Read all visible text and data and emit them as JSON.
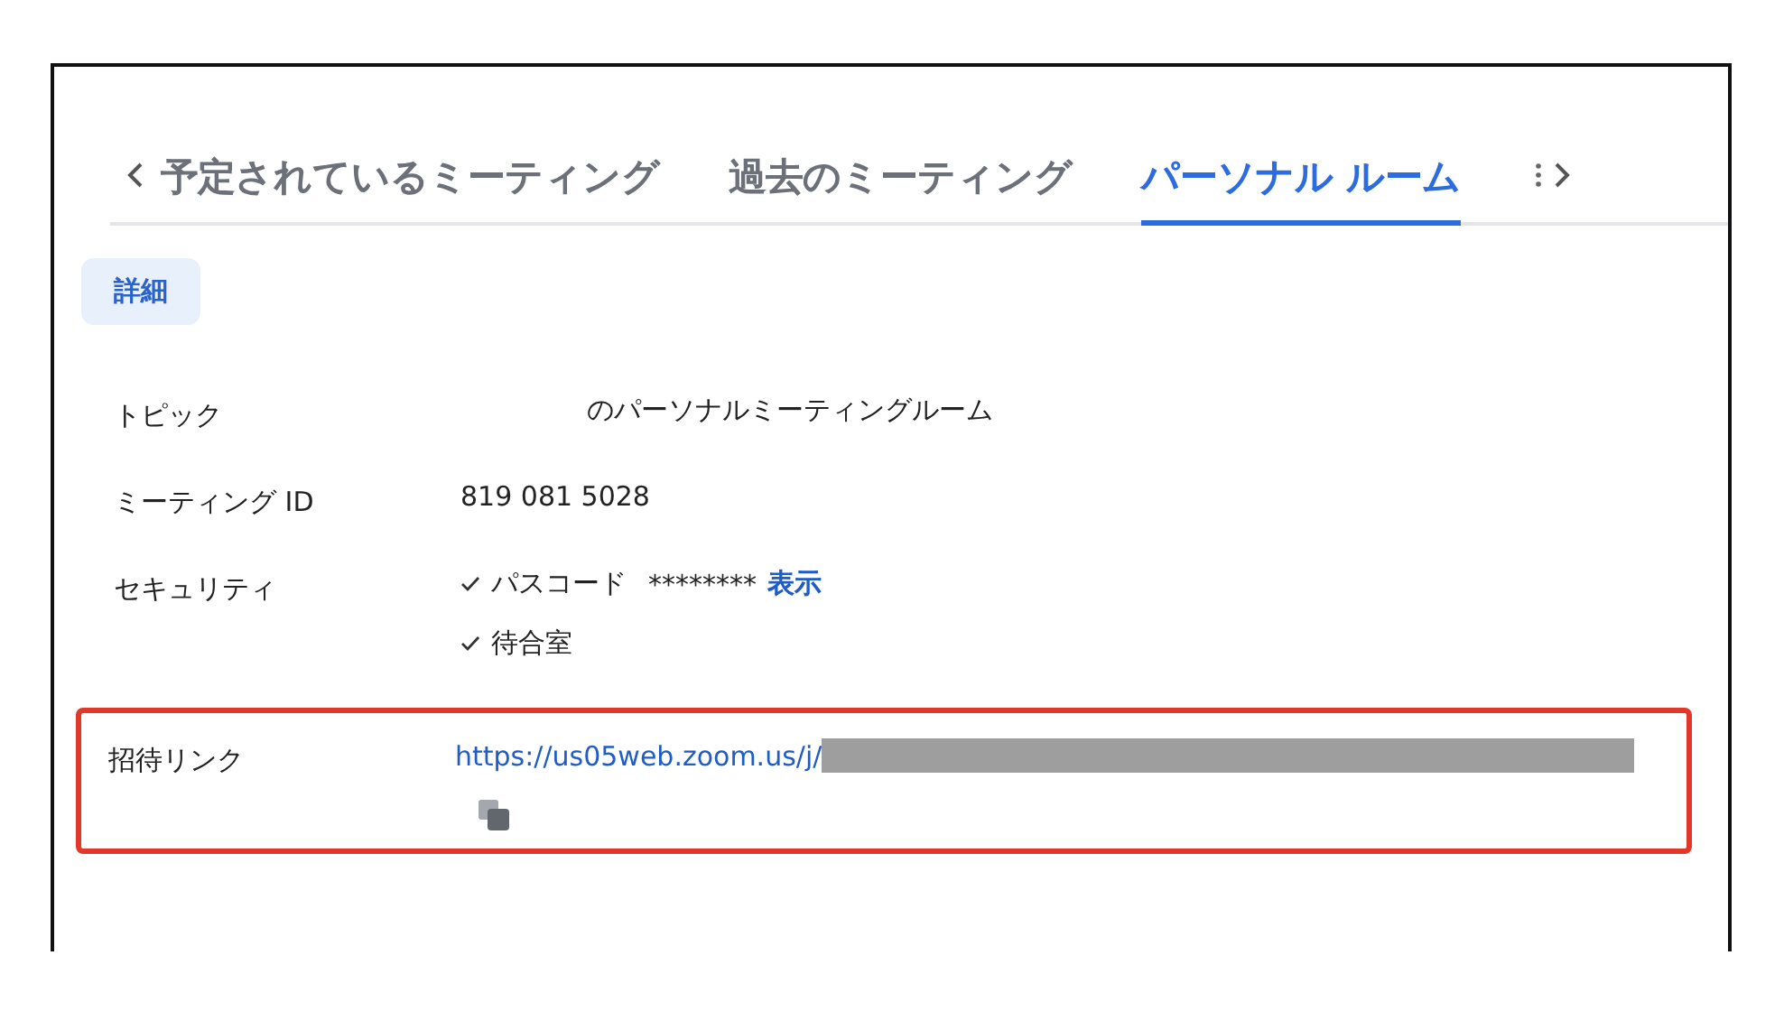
{
  "tabs": [
    {
      "label": "予定されているミーティング",
      "selected": false
    },
    {
      "label": "過去のミーティング",
      "selected": false
    },
    {
      "label": "パーソナル ルーム",
      "selected": true
    }
  ],
  "section_button": "詳細",
  "fields": [
    {
      "kind": "text",
      "label": "トピック",
      "value": "のパーソナルミーティングルーム",
      "redacted": true
    },
    {
      "kind": "text",
      "label": "ミーティング ID",
      "value": "819 081 5028"
    },
    {
      "kind": "checks",
      "label": "セキュリティ",
      "items": [
        {
          "label": "パスコード",
          "checked": true,
          "value": "********",
          "link": "表示"
        },
        {
          "label": "待合室",
          "checked": true
        }
      ]
    },
    {
      "kind": "link",
      "label": "招待リンク",
      "value": "https://us05web.zoom.us/j/",
      "redacted": true,
      "highlighted": true
    }
  ]
}
